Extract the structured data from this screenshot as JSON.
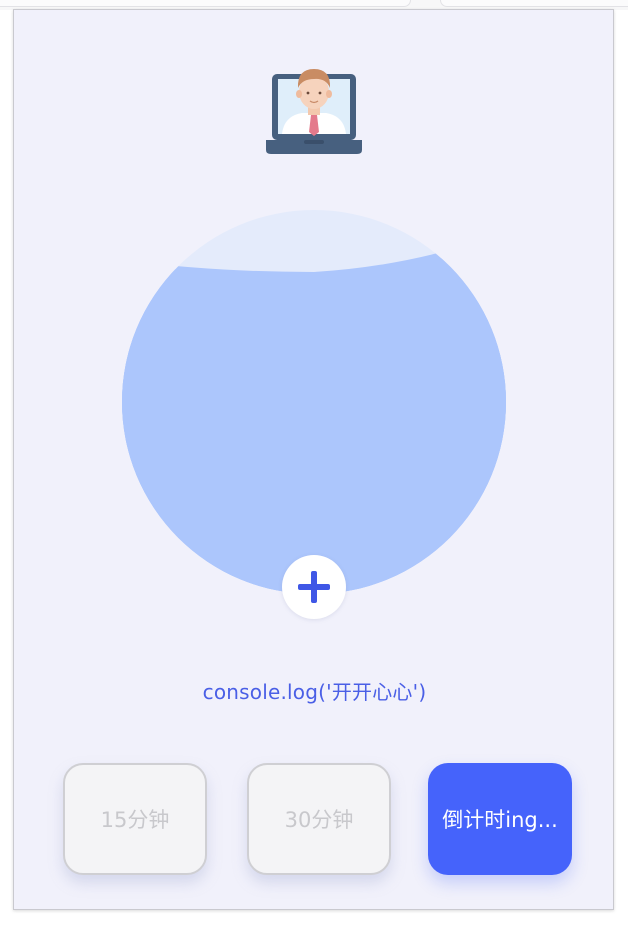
{
  "avatar": {
    "icon": "programmer-laptop-icon"
  },
  "water_ball": {
    "fill_level": 0.83,
    "colors": {
      "water": "#acc6fc",
      "wave": "#c3d5fc",
      "empty": "#e4ebfb"
    }
  },
  "add_button": {
    "icon": "plus-icon",
    "color": "#3f57e6"
  },
  "message": {
    "text": "console.log('开开心心')"
  },
  "timers": [
    {
      "label": "15分钟",
      "state": "idle"
    },
    {
      "label": "30分钟",
      "state": "idle"
    },
    {
      "label": "倒计时ing...",
      "state": "active"
    }
  ],
  "colors": {
    "accent": "#4563fb",
    "background": "#f1f1fb"
  }
}
